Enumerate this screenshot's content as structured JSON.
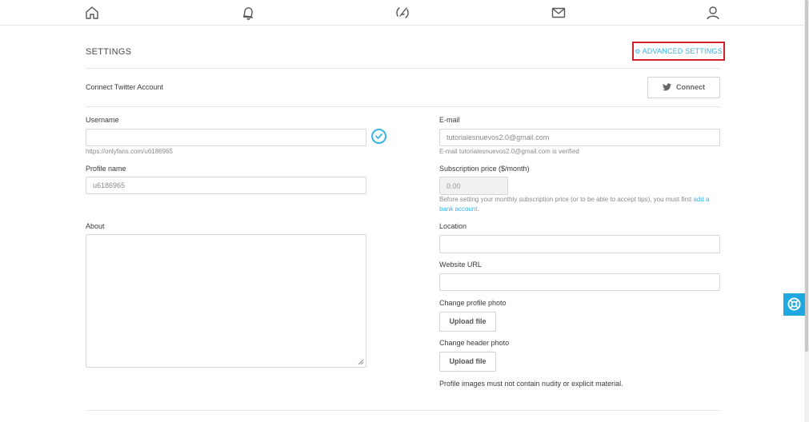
{
  "nav": {
    "items": [
      "home-icon",
      "notifications-icon",
      "new-post-icon",
      "messages-icon",
      "profile-icon"
    ]
  },
  "settings": {
    "title": "SETTINGS",
    "advanced_label": "ADVANCED SETTINGS",
    "twitter_label": "Connect Twitter Account",
    "connect_label": "Connect"
  },
  "left": {
    "username_label": "Username",
    "username_value": "",
    "username_url": "https://onlyfans.com/u6186965",
    "profile_name_label": "Profile name",
    "profile_name_value": "u6186965",
    "about_label": "About",
    "about_value": ""
  },
  "right": {
    "email_label": "E-mail",
    "email_value": "tutorialesnuevos2.0@gmail.com",
    "email_verified": "E-mail tutorialesnuevos2.0@gmail.com is verified",
    "price_label": "Subscription price ($/month)",
    "price_value": "0.00",
    "price_hint_pre": "Before setting your monthly subscription price (or to be able to accept tips), you must first ",
    "price_hint_link": "add a bank account",
    "price_hint_post": ".",
    "location_label": "Location",
    "location_value": "",
    "website_label": "Website URL",
    "website_value": "",
    "profile_photo_label": "Change profile photo",
    "header_photo_label": "Change header photo",
    "upload_label": "Upload file",
    "images_note": "Profile images must not contain nudity or explicit material."
  },
  "colors": {
    "accent": "#37b3e6",
    "highlight_border": "#d0202a",
    "help_button": "#1fa8e0"
  }
}
